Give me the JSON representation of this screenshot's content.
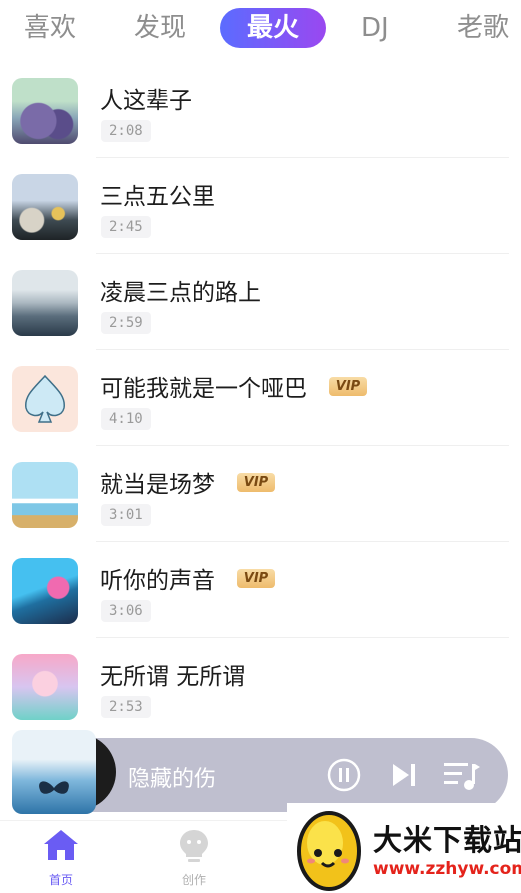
{
  "tabs": [
    {
      "label": "喜欢",
      "active": false
    },
    {
      "label": "发现",
      "active": false
    },
    {
      "label": "最火",
      "active": true
    },
    {
      "label": "DJ",
      "active": false
    },
    {
      "label": "老歌",
      "active": false
    }
  ],
  "songs": [
    {
      "title": "人这辈子",
      "duration": "2:08",
      "vip": false,
      "vip_label": ""
    },
    {
      "title": "三点五公里",
      "duration": "2:45",
      "vip": false,
      "vip_label": ""
    },
    {
      "title": "凌晨三点的路上",
      "duration": "2:59",
      "vip": false,
      "vip_label": ""
    },
    {
      "title": "可能我就是一个哑巴",
      "duration": "4:10",
      "vip": true,
      "vip_label": "VIP"
    },
    {
      "title": "就当是场梦",
      "duration": "3:01",
      "vip": true,
      "vip_label": "VIP"
    },
    {
      "title": "听你的声音",
      "duration": "3:06",
      "vip": true,
      "vip_label": "VIP"
    },
    {
      "title": "无所谓 无所谓",
      "duration": "2:53",
      "vip": false,
      "vip_label": ""
    }
  ],
  "player": {
    "title": "隐藏的伤",
    "icons": [
      "pause-icon",
      "next-icon",
      "playlist-icon"
    ]
  },
  "nav": {
    "home_label": "首页",
    "create_label": "创作"
  },
  "watermark": {
    "text": "大米下载站",
    "url": "www.zzhyw.com"
  },
  "colors": {
    "accent": "#6a5cf3",
    "tab_gradient_start": "#5b6cff",
    "tab_gradient_end": "#9a48f0",
    "vip_bg": "#eebb6c",
    "player_bg": "#bfbfcf"
  }
}
